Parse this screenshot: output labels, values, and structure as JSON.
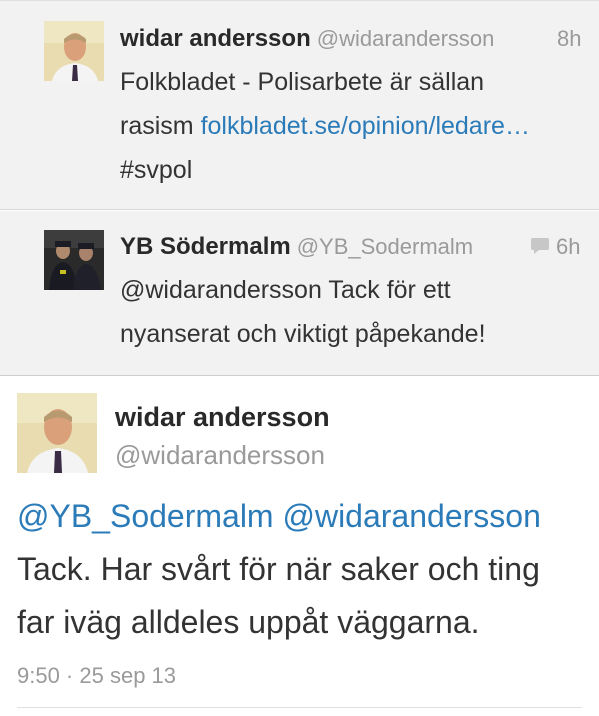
{
  "thread": [
    {
      "name": "widar andersson",
      "handle": "@widarandersson",
      "time": "8h",
      "text_line1": "Folkbladet - Polisarbete är sällan",
      "text_line2_plain": "rasism ",
      "text_line2_link": "folkbladet.se/opinion/ledare…",
      "text_line3": "#svpol"
    },
    {
      "name": "YB Södermalm",
      "handle": "@YB_Sodermalm",
      "time": "6h",
      "icon": "reply-bubble-icon",
      "text_line1": "@widarandersson Tack för ett",
      "text_line2": "nyanserat och viktigt påpekande!"
    }
  ],
  "main": {
    "name": "widar andersson",
    "handle": "@widarandersson",
    "mention1": "@YB_Sodermalm",
    "mention2": "@widarandersson",
    "text_line2": "Tack. Har svårt för när saker och ting",
    "text_line3": "far iväg alldeles uppåt väggarna.",
    "meta": "9:50 · 25 sep 13"
  },
  "colors": {
    "link": "#2b7bb9",
    "muted": "#9a9a9a",
    "thread_bg": "#f2f2f2"
  }
}
